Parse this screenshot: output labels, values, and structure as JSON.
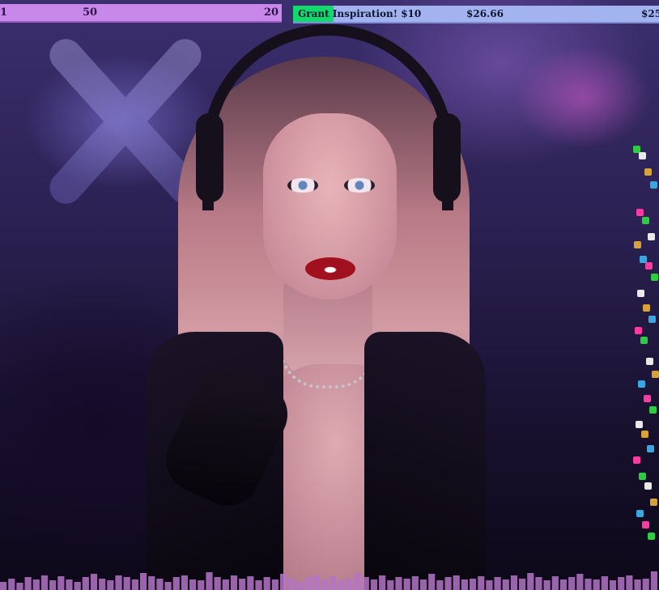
{
  "overlay": {
    "goal_bar": {
      "left_value": "1",
      "mid_value": "50",
      "right_value": "20",
      "progress": 1.0,
      "color": "#c788ea"
    },
    "hype_train": {
      "title": "Grant Inspiration! $10",
      "amount_1": "$26.66",
      "amount_2": "$25",
      "progress": 0.11,
      "fill_color": "#12d96b",
      "bar_color": "#a3b3f0"
    }
  },
  "chat_badges": {
    "colors": [
      "#2ecc40",
      "#e8e8e8",
      "#d8a23a",
      "#3aa8e0",
      "#ff3aa0"
    ],
    "icons": [
      "check-badge",
      "gift-badge",
      "sword-badge",
      "heart-badge",
      "speaker-badge"
    ]
  },
  "visualizer": {
    "levels": [
      0.4,
      0.55,
      0.35,
      0.6,
      0.5,
      0.7,
      0.45,
      0.65,
      0.5,
      0.4,
      0.6,
      0.75,
      0.55,
      0.45,
      0.7,
      0.6,
      0.5,
      0.8,
      0.65,
      0.55,
      0.4,
      0.6,
      0.7,
      0.5,
      0.45,
      0.85,
      0.6,
      0.5,
      0.7,
      0.55,
      0.65,
      0.45,
      0.6,
      0.5,
      0.75,
      0.55,
      0.4,
      0.6,
      0.7,
      0.5,
      0.65,
      0.45,
      0.55,
      0.8,
      0.6,
      0.5,
      0.7,
      0.45,
      0.6,
      0.55,
      0.65,
      0.5,
      0.75,
      0.45,
      0.6,
      0.7,
      0.5,
      0.55,
      0.65,
      0.45,
      0.6,
      0.5,
      0.7,
      0.55,
      0.8,
      0.6,
      0.45,
      0.65,
      0.5,
      0.6,
      0.75,
      0.55,
      0.5,
      0.65,
      0.45,
      0.6,
      0.7,
      0.5,
      0.55,
      0.9
    ],
    "color": "#b474c8"
  }
}
